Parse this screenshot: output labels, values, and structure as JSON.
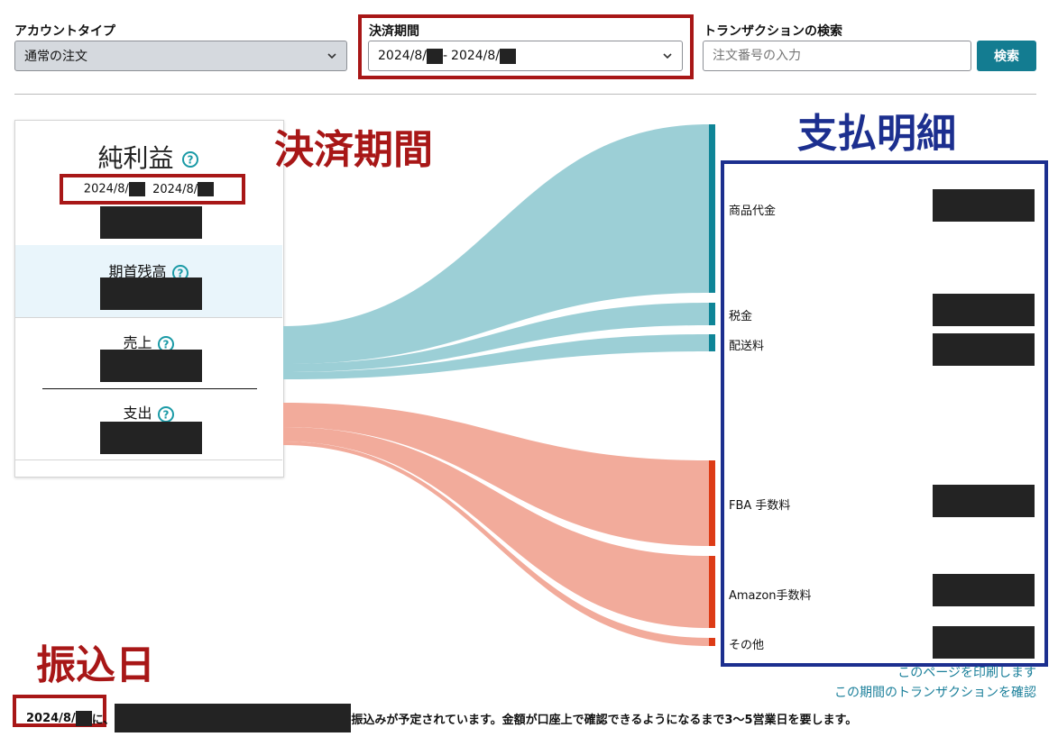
{
  "filters": {
    "account_type": {
      "label": "アカウントタイプ",
      "value": "通常の注文"
    },
    "settlement_period": {
      "label": "決済期間",
      "value_start": "2024/8/",
      "value_end": "2024/8/",
      "separator": "-"
    },
    "transaction_search": {
      "label": "トランザクションの検索",
      "placeholder": "注文番号の入力",
      "button": "検索"
    }
  },
  "summary_card": {
    "net_profit_title": "純利益",
    "period_start": "2024/8/",
    "period_end": "2024/8/",
    "opening_balance_label": "期首残高",
    "sales_label": "売上",
    "expenses_label": "支出"
  },
  "annotations": {
    "settlement_period": "決済期間",
    "payment_details": "支払明細",
    "transfer_date": "振込日"
  },
  "breakdown": {
    "items": [
      {
        "label": "商品代金",
        "type": "income"
      },
      {
        "label": "税金",
        "type": "income"
      },
      {
        "label": "配送料",
        "type": "income"
      },
      {
        "label": "FBA 手数料",
        "type": "expense"
      },
      {
        "label": "Amazon手数料",
        "type": "expense"
      },
      {
        "label": "その他",
        "type": "expense"
      }
    ]
  },
  "links": {
    "print": "このページを印刷します",
    "transactions": "この期間のトランザクションを確認"
  },
  "footer": {
    "date": "2024/8/",
    "connector": "に、",
    "message": "振込みが予定されています。金額が口座上で確認できるようになるまで3〜5営業日を要します。"
  },
  "colors": {
    "income_flow": "#9ccfd6",
    "income_bar": "#0f8597",
    "expense_flow": "#f2ab9b",
    "expense_bar": "#dd3b16",
    "annotation_red": "#a81717",
    "annotation_blue": "#1c2f8f",
    "link": "#1a7f9a",
    "button": "#137c91"
  }
}
